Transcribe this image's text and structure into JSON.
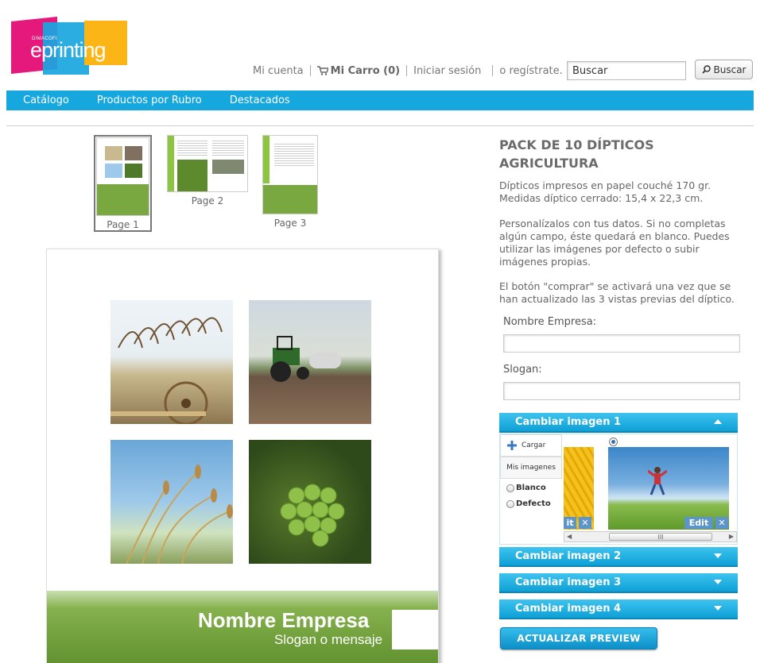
{
  "brand": {
    "logo_small": "DIMACOFI",
    "logo_big": "eprinting"
  },
  "topnav": {
    "account": "Mi cuenta",
    "cart": "Mi Carro (0)",
    "login": "Iniciar sesión",
    "register": "o regístrate.",
    "search_value": "Buscar",
    "search_button": "Buscar"
  },
  "mainnav": [
    "Catálogo",
    "Productos por Rubro",
    "Destacados"
  ],
  "thumbnails": [
    {
      "caption": "Page 1"
    },
    {
      "caption": "Page 2"
    },
    {
      "caption": "Page 3"
    }
  ],
  "preview": {
    "company_name": "Nombre Empresa",
    "slogan": "Slogan o mensaje"
  },
  "product": {
    "title": "PACK DE 10 DÍPTICOS AGRICULTURA",
    "desc1": "Dípticos impresos en papel couché 170 gr. Medidas díptico cerrado: 15,4 x 22,3 cm.",
    "desc2": "Personalízalos con tus datos. Si no completas algún campo, éste quedará en blanco. Puedes utilizar las imágenes por defecto o subir imágenes propias.",
    "desc3": "El botón \"comprar\" se activará una vez que se han actualizado las 3 vistas previas del díptico."
  },
  "form": {
    "company_label": "Nombre Empresa:",
    "company_value": "",
    "slogan_label": "Slogan:",
    "slogan_value": ""
  },
  "accordion": {
    "items": [
      "Cambiar imagen 1",
      "Cambiar imagen 2",
      "Cambiar imagen 3",
      "Cambiar imagen 4"
    ],
    "upload_tab": "Cargar",
    "my_images_tab": "Mis imagenes",
    "option_blank": "Blanco",
    "option_default": "Defecto",
    "edit_short": "it",
    "edit": "Edit",
    "delete": "✕",
    "scroll_grip": "III"
  },
  "update_button": "ACTUALIZAR PREVIEW",
  "colors": {
    "accent": "#16a7df",
    "logo_pink": "#e4197b",
    "logo_blue": "#19a6e0",
    "logo_yellow": "#fbb516"
  }
}
